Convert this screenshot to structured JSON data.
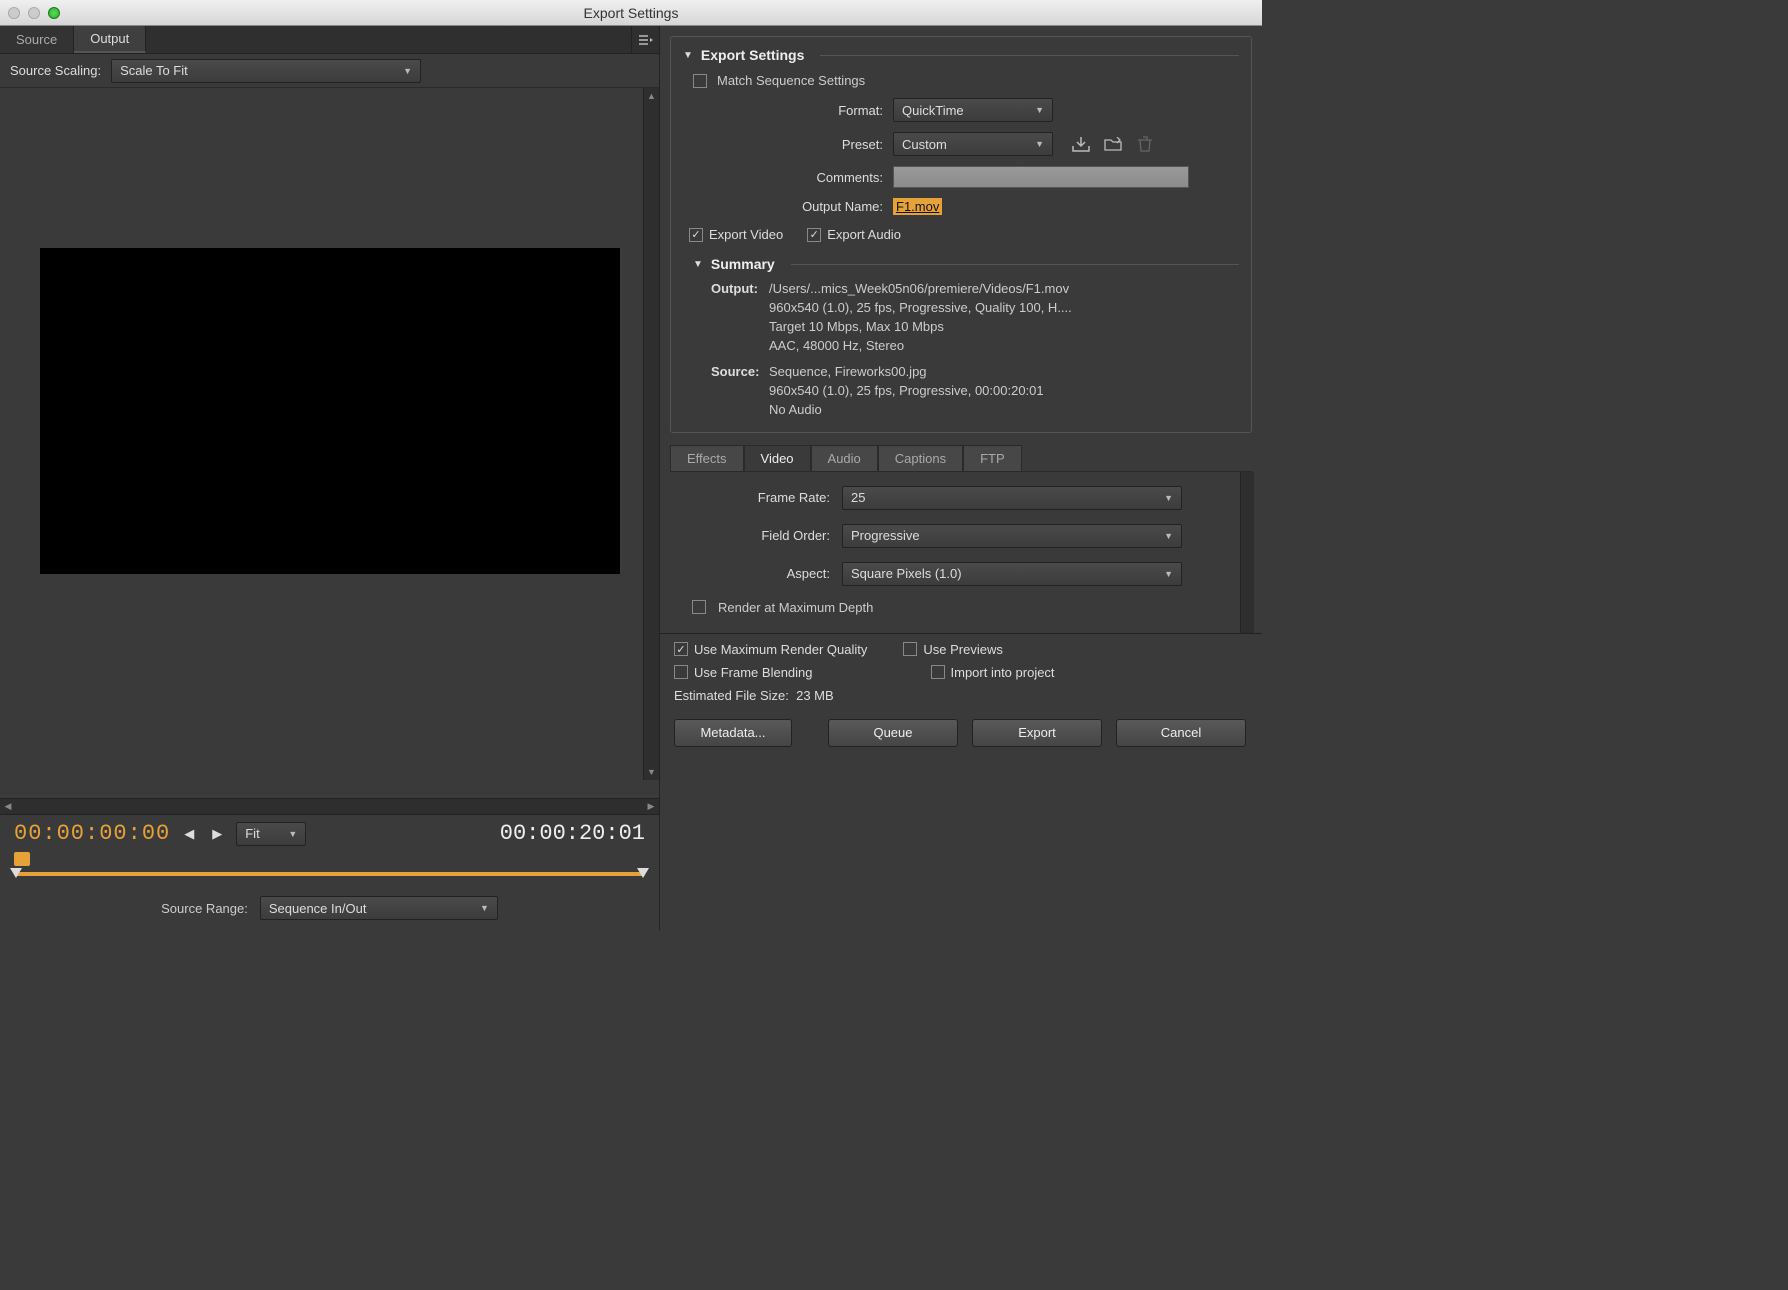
{
  "window": {
    "title": "Export Settings"
  },
  "left": {
    "tabs": [
      "Source",
      "Output"
    ],
    "activeTab": 1,
    "sourceScalingLabel": "Source Scaling:",
    "sourceScalingValue": "Scale To Fit",
    "tcIn": "00:00:00:00",
    "tcOut": "00:00:20:01",
    "fitLabel": "Fit",
    "sourceRangeLabel": "Source Range:",
    "sourceRangeValue": "Sequence In/Out"
  },
  "export": {
    "heading": "Export Settings",
    "matchSeqLabel": "Match Sequence Settings",
    "matchSeqChecked": false,
    "formatLabel": "Format:",
    "formatValue": "QuickTime",
    "presetLabel": "Preset:",
    "presetValue": "Custom",
    "commentsLabel": "Comments:",
    "commentsValue": "",
    "outputNameLabel": "Output Name:",
    "outputNameValue": "F1.mov",
    "exportVideoLabel": "Export Video",
    "exportVideoChecked": true,
    "exportAudioLabel": "Export Audio",
    "exportAudioChecked": true
  },
  "summary": {
    "heading": "Summary",
    "outputKey": "Output:",
    "outputLines": [
      "/Users/...mics_Week05n06/premiere/Videos/F1.mov",
      "960x540 (1.0), 25 fps, Progressive, Quality 100, H....",
      "Target 10 Mbps, Max 10 Mbps",
      "AAC, 48000 Hz, Stereo"
    ],
    "sourceKey": "Source:",
    "sourceLines": [
      "Sequence, Fireworks00.jpg",
      "960x540 (1.0), 25 fps, Progressive, 00:00:20:01",
      "No Audio"
    ]
  },
  "codecTabs": [
    "Effects",
    "Video",
    "Audio",
    "Captions",
    "FTP"
  ],
  "codecActive": 1,
  "video": {
    "frameRateLabel": "Frame Rate:",
    "frameRateValue": "25",
    "fieldOrderLabel": "Field Order:",
    "fieldOrderValue": "Progressive",
    "aspectLabel": "Aspect:",
    "aspectValue": "Square Pixels (1.0)",
    "renderMaxDepthLabel": "Render at Maximum Depth",
    "renderMaxDepthChecked": false
  },
  "bottom": {
    "useMaxQualityLabel": "Use Maximum Render Quality",
    "useMaxQualityChecked": true,
    "usePreviewsLabel": "Use Previews",
    "usePreviewsChecked": false,
    "useFrameBlendLabel": "Use Frame Blending",
    "useFrameBlendChecked": false,
    "importProjectLabel": "Import into project",
    "importProjectChecked": false,
    "estLabel": "Estimated File Size:",
    "estValue": "23 MB"
  },
  "buttons": {
    "metadata": "Metadata...",
    "queue": "Queue",
    "export": "Export",
    "cancel": "Cancel"
  }
}
